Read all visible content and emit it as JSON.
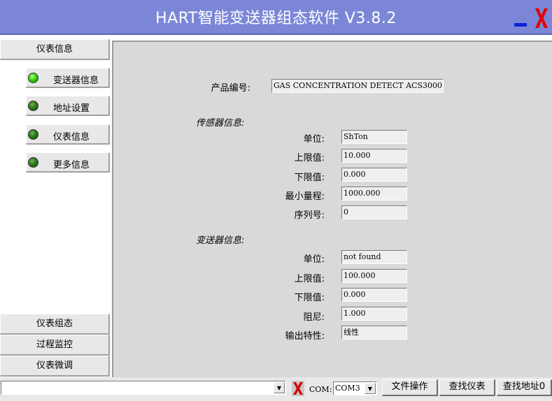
{
  "app": {
    "title": "HART智能变送器组态软件   V3.8.2"
  },
  "window": {
    "minimize_icon": "minimize-icon",
    "close_icon": "close-x-icon",
    "close_color": "#e30000",
    "minimize_color": "#0d1fd9"
  },
  "sidebar": {
    "header_top": "仪表信息",
    "items": [
      {
        "label": "变送器信息",
        "status": "active",
        "icon": "led-green-icon"
      },
      {
        "label": "地址设置",
        "status": "inactive",
        "icon": "led-green-icon"
      },
      {
        "label": "仪表信息",
        "status": "inactive",
        "icon": "led-green-icon"
      },
      {
        "label": "更多信息",
        "status": "inactive",
        "icon": "led-green-icon"
      }
    ],
    "bottom_headers": [
      "仪表组态",
      "过程监控",
      "仪表微调"
    ]
  },
  "main": {
    "product": {
      "label": "产品编号:",
      "value": "GAS CONCENTRATION DETECT ACS3000"
    },
    "sensor": {
      "title": "传感器信息:",
      "fields": [
        {
          "label": "单位:",
          "value": "ShTon"
        },
        {
          "label": "上限值:",
          "value": "10.000"
        },
        {
          "label": "下限值:",
          "value": "0.000"
        },
        {
          "label": "最小量程:",
          "value": "1000.000"
        },
        {
          "label": "序列号:",
          "value": "0"
        }
      ]
    },
    "transmitter": {
      "title": "变送器信息:",
      "fields": [
        {
          "label": "单位:",
          "value": "not found"
        },
        {
          "label": "上限值:",
          "value": "100.000"
        },
        {
          "label": "下限值:",
          "value": "0.000"
        },
        {
          "label": "阻尼:",
          "value": "1.000"
        },
        {
          "label": "输出特性:",
          "value": "线性"
        }
      ]
    }
  },
  "statusbar": {
    "path_value": "",
    "connection_icon": "disconnected-x-icon",
    "com_label": "COM:",
    "com_value": "COM3",
    "buttons": [
      "文件操作",
      "查找仪表",
      "查找地址0"
    ]
  }
}
